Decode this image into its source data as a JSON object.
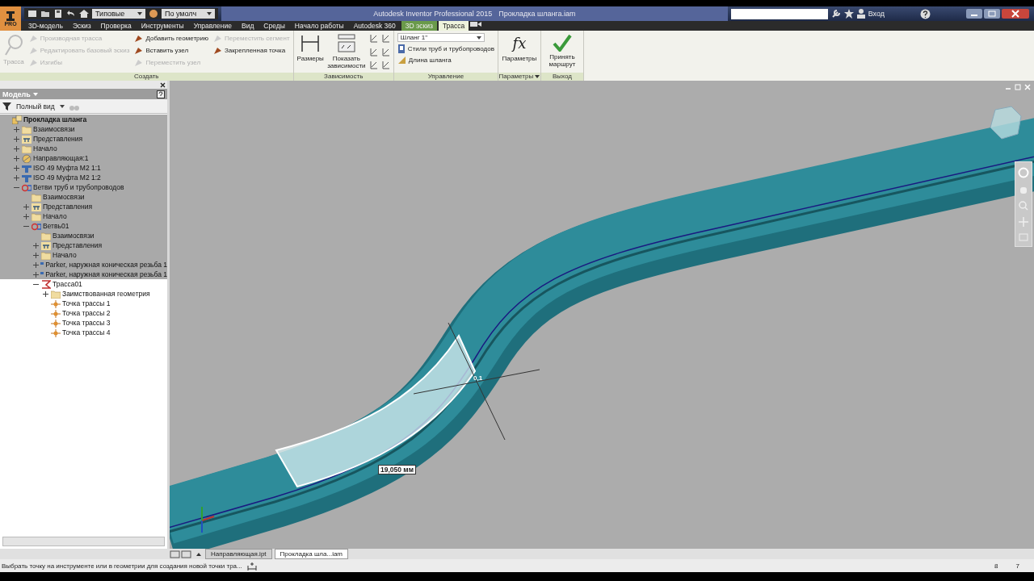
{
  "title_bar": {
    "app_badge": "PRO",
    "app_title": "Autodesk Inventor Professional 2015",
    "document_title": "Прокладка шланга.iam",
    "sign_in": "Вход"
  },
  "quick_access": {
    "style_dropdown": "Типовые",
    "appearance_dropdown": "По умолч"
  },
  "menu_tabs": [
    {
      "label": "3D-модель",
      "selected": false,
      "kind": "normal"
    },
    {
      "label": "Эскиз",
      "selected": false,
      "kind": "normal"
    },
    {
      "label": "Проверка",
      "selected": false,
      "kind": "normal"
    },
    {
      "label": "Инструменты",
      "selected": false,
      "kind": "normal"
    },
    {
      "label": "Управление",
      "selected": false,
      "kind": "normal"
    },
    {
      "label": "Вид",
      "selected": false,
      "kind": "normal"
    },
    {
      "label": "Среды",
      "selected": false,
      "kind": "normal"
    },
    {
      "label": "Начало работы",
      "selected": false,
      "kind": "normal"
    },
    {
      "label": "Autodesk 360",
      "selected": false,
      "kind": "normal"
    },
    {
      "label": "3D эскиз",
      "selected": false,
      "kind": "context"
    },
    {
      "label": "Трасса",
      "selected": true,
      "kind": "context"
    }
  ],
  "ribbon": {
    "create": {
      "title": "Создать",
      "main_tool": {
        "label": "Трасса",
        "disabled": true
      },
      "columns": [
        [
          {
            "label": "Производная трасса",
            "disabled": true
          },
          {
            "label": "Редактировать базовый эскиз",
            "disabled": true
          },
          {
            "label": "Изгибы",
            "disabled": true
          }
        ],
        [
          {
            "label": "Добавить геометрию",
            "disabled": false
          },
          {
            "label": "Вставить узел",
            "disabled": false
          },
          {
            "label": "Переместить узел",
            "disabled": true
          }
        ],
        [
          {
            "label": "Переместить сегмент",
            "disabled": true
          },
          {
            "label": "Закрепленная точка",
            "disabled": false
          }
        ]
      ]
    },
    "constraint": {
      "title": "Зависимость",
      "tools": [
        "Размеры",
        "Показать зависимости"
      ]
    },
    "manage": {
      "title": "Управление",
      "hose_dropdown": "Шланг 1\"",
      "tools": [
        "Стили труб и трубопроводов",
        "Длина шланга"
      ]
    },
    "parameters": {
      "title": "Параметры",
      "symbol": "fx",
      "tool": "Параметры"
    },
    "exit": {
      "title": "Выход",
      "tool": "Принять маршрут"
    }
  },
  "browser": {
    "title": "Модель",
    "view_mode": "Полный вид",
    "tree": [
      {
        "label": "Прокладка шланга",
        "kind": "assembly",
        "inactive": true,
        "children": [
          {
            "label": "Взаимосвязи",
            "kind": "folder",
            "inactive": true,
            "expanded": false
          },
          {
            "label": "Представления",
            "kind": "views",
            "inactive": true,
            "expanded": false
          },
          {
            "label": "Начало",
            "kind": "folder",
            "inactive": true,
            "expanded": false
          },
          {
            "label": "Направляющая:1",
            "kind": "part",
            "inactive": true,
            "expanded": false
          },
          {
            "label": "ISO 49 Муфта М2 1:1",
            "kind": "fitting",
            "inactive": true,
            "expanded": false
          },
          {
            "label": "ISO 49 Муфта М2 1:2",
            "kind": "fitting",
            "inactive": true,
            "expanded": false
          },
          {
            "label": "Ветви труб и трубопроводов",
            "kind": "run",
            "inactive": true,
            "expanded": true,
            "children": [
              {
                "label": "Взаимосвязи",
                "kind": "folder",
                "inactive": true
              },
              {
                "label": "Представления",
                "kind": "views",
                "inactive": true,
                "expanded": false
              },
              {
                "label": "Начало",
                "kind": "folder",
                "inactive": true,
                "expanded": false
              },
              {
                "label": "Ветвь01",
                "kind": "run",
                "inactive": true,
                "expanded": true,
                "children": [
                  {
                    "label": "Взаимосвязи",
                    "kind": "folder",
                    "inactive": true
                  },
                  {
                    "label": "Представления",
                    "kind": "views",
                    "inactive": true,
                    "expanded": false
                  },
                  {
                    "label": "Начало",
                    "kind": "folder",
                    "inactive": true,
                    "expanded": false
                  },
                  {
                    "label": "Parker, наружная коническая резьба 1",
                    "kind": "fitting",
                    "inactive": true,
                    "expanded": false
                  },
                  {
                    "label": "Parker, наружная коническая резьба 1",
                    "kind": "fitting",
                    "inactive": true,
                    "expanded": false
                  },
                  {
                    "label": "Трасса01",
                    "kind": "route",
                    "inactive": false,
                    "expanded": true,
                    "children": [
                      {
                        "label": "Заимствованная геометрия",
                        "kind": "folder",
                        "inactive": false,
                        "expanded": false
                      },
                      {
                        "label": "Точка трассы 1",
                        "kind": "point",
                        "inactive": false
                      },
                      {
                        "label": "Точка трассы 2",
                        "kind": "point",
                        "inactive": false
                      },
                      {
                        "label": "Точка трассы 3",
                        "kind": "point",
                        "inactive": false
                      },
                      {
                        "label": "Точка трассы 4",
                        "kind": "point",
                        "inactive": false
                      }
                    ]
                  }
                ]
              }
            ]
          }
        ]
      }
    ]
  },
  "viewport": {
    "dimension": "19,050 мм",
    "point_label": "0,1"
  },
  "document_tabs": [
    {
      "label": "Направляющая.ipt",
      "selected": false
    },
    {
      "label": "Прокладка шла...iam",
      "selected": true
    }
  ],
  "status_bar": {
    "message": "Выбрать точку на инструменте или в геометрии для создания новой точки тра...",
    "values": [
      "8",
      "7"
    ]
  }
}
